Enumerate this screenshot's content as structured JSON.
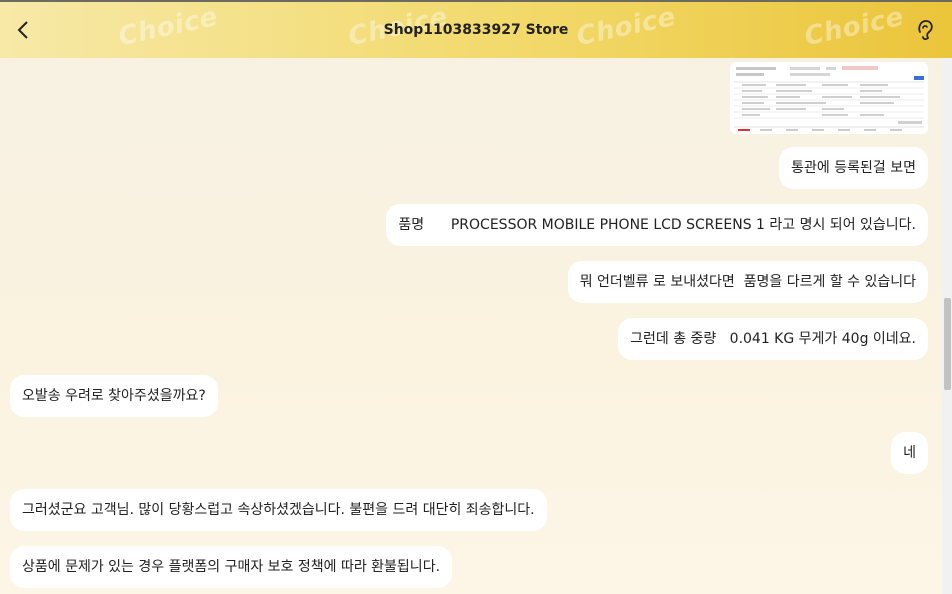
{
  "header": {
    "title": "Shop1103833927 Store",
    "watermark": "Choice",
    "accent_left": "#f7e9a7",
    "accent_right": "#ebc53a"
  },
  "icons": {
    "back": "chevron-left-icon",
    "right": "customer-service-icon"
  },
  "messages": [
    {
      "side": "right",
      "type": "image",
      "description": "screenshot"
    },
    {
      "side": "right",
      "type": "text",
      "text": "통관에 등록된걸 보면"
    },
    {
      "side": "right",
      "type": "text",
      "text": "품명      PROCESSOR MOBILE PHONE LCD SCREENS 1 라고 명시 되어 있습니다."
    },
    {
      "side": "right",
      "type": "text",
      "text": "뭐 언더벨류 로 보내셨다면  품명을 다르게 할 수 있습니다"
    },
    {
      "side": "right",
      "type": "text",
      "text": "그런데 총 중량   0.041 KG 무게가 40g 이네요."
    },
    {
      "side": "left",
      "type": "text",
      "text": "오발송 우려로 찾아주셨을까요?"
    },
    {
      "side": "right",
      "type": "text",
      "text": "네"
    },
    {
      "side": "left",
      "type": "text",
      "text": "그러셨군요 고객님. 많이 당황스럽고 속상하셨겠습니다. 불편을 드려 대단히 죄송합니다."
    },
    {
      "side": "left",
      "type": "text",
      "text": "상품에 문제가 있는 경우 플랫폼의 구매자 보호 정책에 따라 환불됩니다."
    }
  ]
}
